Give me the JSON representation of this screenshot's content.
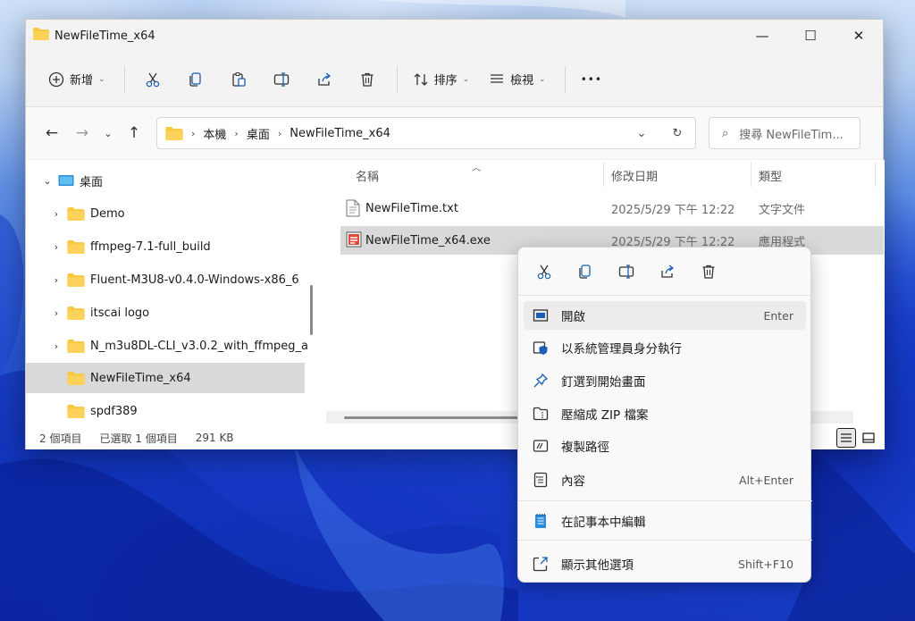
{
  "window": {
    "title": "NewFileTime_x64",
    "minimize_glyph": "—",
    "maximize_glyph": "☐",
    "close_glyph": "✕"
  },
  "commandbar": {
    "new_label": "新增",
    "sort_label": "排序",
    "view_label": "檢視",
    "more_label": "•••"
  },
  "address": {
    "crumbs": [
      "本機",
      "桌面",
      "NewFileTime_x64"
    ],
    "search_placeholder": "搜尋 NewFileTim..."
  },
  "tree": {
    "items": [
      {
        "label": "桌面",
        "icon": "desktop-icon",
        "expanded": true
      },
      {
        "label": "Demo",
        "icon": "folder-icon"
      },
      {
        "label": "ffmpeg-7.1-full_build",
        "icon": "folder-icon"
      },
      {
        "label": "Fluent-M3U8-v0.4.0-Windows-x86_6",
        "icon": "folder-icon"
      },
      {
        "label": "itscai logo",
        "icon": "folder-icon"
      },
      {
        "label": "N_m3u8DL-CLI_v3.0.2_with_ffmpeg_a",
        "icon": "folder-icon"
      },
      {
        "label": "NewFileTime_x64",
        "icon": "folder-icon",
        "selected": true
      },
      {
        "label": "spdf389",
        "icon": "folder-icon"
      }
    ]
  },
  "files": {
    "columns": [
      "名稱",
      "修改日期",
      "類型"
    ],
    "rows": [
      {
        "name": "NewFileTime.txt",
        "date": "2025/5/29 下午 12:22",
        "type": "文字文件",
        "icon": "text-file-icon"
      },
      {
        "name": "NewFileTime_x64.exe",
        "date": "2025/5/29 下午 12:22",
        "type": "應用程式",
        "icon": "exe-file-icon",
        "selected": true
      }
    ]
  },
  "status": {
    "count": "2 個項目",
    "selected": "已選取 1 個項目",
    "size": "291 KB"
  },
  "context_menu": {
    "icon_actions": [
      "cut-icon",
      "copy-icon",
      "rename-icon",
      "share-icon",
      "delete-icon"
    ],
    "items": [
      {
        "label": "開啟",
        "shortcut": "Enter",
        "icon": "open-icon"
      },
      {
        "label": "以系統管理員身分執行",
        "shortcut": "",
        "icon": "admin-shield-icon"
      },
      {
        "label": "釘選到開始畫面",
        "shortcut": "",
        "icon": "pin-icon"
      },
      {
        "label": "壓縮成 ZIP 檔案",
        "shortcut": "",
        "icon": "zip-icon"
      },
      {
        "label": "複製路徑",
        "shortcut": "",
        "icon": "copy-path-icon"
      },
      {
        "label": "內容",
        "shortcut": "Alt+Enter",
        "icon": "properties-icon"
      },
      {
        "label": "在記事本中編輯",
        "shortcut": "",
        "icon": "notepad-icon"
      },
      {
        "label": "顯示其他選項",
        "shortcut": "Shift+F10",
        "icon": "more-options-icon"
      }
    ]
  },
  "colors": {
    "accent": "#0067c0",
    "folder": "#f8c840",
    "selection": "#d9d9d9"
  }
}
